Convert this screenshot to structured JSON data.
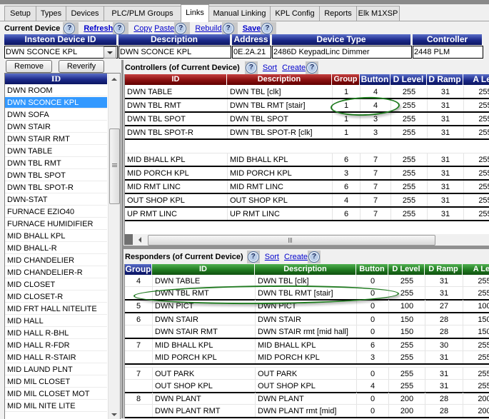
{
  "tabs": [
    "Setup",
    "Types",
    "Devices",
    "PLC/PLM Groups",
    "Links",
    "Manual Linking",
    "KPL Config",
    "Reports",
    "Elk M1XSP"
  ],
  "active_tab": "Links",
  "toolbar": {
    "current_device_label": "Current Device",
    "refresh": "Refresh",
    "copy": "Copy",
    "paste": "Paste",
    "rebuild": "Rebuild",
    "save": "Save",
    "help_glyph": "?"
  },
  "device": {
    "headers": [
      "Insteon Device ID",
      "Description",
      "Address",
      "Device Type",
      "Controller"
    ],
    "id": "DWN SCONCE KPL",
    "description": "DWN SCONCE KPL",
    "address": "0E.2A.21",
    "device_type": "2486D KeypadLinc Dimmer",
    "controller": "2448 PLM"
  },
  "buttons": {
    "remove": "Remove",
    "reverify": "Reverify"
  },
  "device_list": {
    "header": "ID",
    "selected": "DWN SCONCE KPL",
    "items": [
      "DWN ROOM",
      "DWN SCONCE KPL",
      "DWN SOFA",
      "DWN STAIR",
      "DWN STAIR RMT",
      "DWN TABLE",
      "DWN TBL RMT",
      "DWN TBL SPOT",
      "DWN TBL SPOT-R",
      "DWN-STAT",
      "FURNACE EZIO40",
      "FURNACE HUMIDIFIER",
      "MID BHALL KPL",
      "MID BHALL-R",
      "MID CHANDELIER",
      "MID CHANDELIER-R",
      "MID CLOSET",
      "MID CLOSET-R",
      "MID FRT HALL NITELITE",
      "MID HALL",
      "MID HALL R-BHL",
      "MID HALL R-FDR",
      "MID HALL R-STAIR",
      "MID LAUND PLNT",
      "MID MIL CLOSET",
      "MID MIL CLOSET MOT",
      "MID MIL NITE LITE"
    ]
  },
  "controllers": {
    "title": "Controllers (of Current Device)",
    "sort": "Sort",
    "create": "Create",
    "headers": [
      "ID",
      "Description",
      "Group",
      "Button",
      "D Level",
      "D Ramp",
      "A Lev"
    ],
    "rows": [
      {
        "id": "DWN TABLE",
        "desc": "DWN TBL [clk]",
        "group": "1",
        "button": "4",
        "dlevel": "255",
        "dramp": "31",
        "alevel": "255"
      },
      {
        "id": "DWN TBL RMT",
        "desc": "DWN TBL RMT [stair]",
        "group": "1",
        "button": "4",
        "dlevel": "255",
        "dramp": "31",
        "alevel": "255"
      },
      {
        "id": "DWN TBL SPOT",
        "desc": "DWN TBL SPOT",
        "group": "1",
        "button": "3",
        "dlevel": "255",
        "dramp": "31",
        "alevel": "255"
      },
      {
        "id": "DWN TBL SPOT-R",
        "desc": "DWN TBL SPOT-R [clk]",
        "group": "1",
        "button": "3",
        "dlevel": "255",
        "dramp": "31",
        "alevel": "255"
      },
      {
        "id": "MID BHALL KPL",
        "desc": "MID BHALL KPL",
        "group": "6",
        "button": "7",
        "dlevel": "255",
        "dramp": "31",
        "alevel": "255"
      },
      {
        "id": "MID PORCH KPL",
        "desc": "MID PORCH KPL",
        "group": "3",
        "button": "7",
        "dlevel": "255",
        "dramp": "31",
        "alevel": "255"
      },
      {
        "id": "MID RMT LINC",
        "desc": "MID RMT LINC",
        "group": "6",
        "button": "7",
        "dlevel": "255",
        "dramp": "31",
        "alevel": "255"
      },
      {
        "id": "OUT SHOP KPL",
        "desc": "OUT SHOP KPL",
        "group": "4",
        "button": "7",
        "dlevel": "255",
        "dramp": "31",
        "alevel": "255"
      },
      {
        "id": "UP RMT LINC",
        "desc": "UP RMT LINC",
        "group": "6",
        "button": "7",
        "dlevel": "255",
        "dramp": "31",
        "alevel": "255"
      }
    ]
  },
  "responders": {
    "title": "Responders (of Current Device)",
    "sort": "Sort",
    "create": "Create",
    "headers": [
      "Group",
      "ID",
      "Description",
      "Button",
      "D Level",
      "D Ramp",
      "A Lev"
    ],
    "rows": [
      {
        "group": "4",
        "id": "DWN TABLE",
        "desc": "DWN TBL [clk]",
        "button": "0",
        "dlevel": "255",
        "dramp": "31",
        "alevel": "255"
      },
      {
        "group": "",
        "id": "DWN TBL RMT",
        "desc": "DWN TBL RMT [stair]",
        "button": "0",
        "dlevel": "255",
        "dramp": "31",
        "alevel": "255"
      },
      {
        "group": "5",
        "id": "DWN PICT",
        "desc": "DWN PICT",
        "button": "0",
        "dlevel": "100",
        "dramp": "27",
        "alevel": "100"
      },
      {
        "group": "6",
        "id": "DWN STAIR",
        "desc": "DWN STAIR",
        "button": "0",
        "dlevel": "150",
        "dramp": "28",
        "alevel": "150"
      },
      {
        "group": "",
        "id": "DWN STAIR RMT",
        "desc": "DWN STAIR rmt [mid hall]",
        "button": "0",
        "dlevel": "150",
        "dramp": "28",
        "alevel": "150"
      },
      {
        "group": "7",
        "id": "MID BHALL KPL",
        "desc": "MID BHALL KPL",
        "button": "6",
        "dlevel": "255",
        "dramp": "30",
        "alevel": "255"
      },
      {
        "group": "",
        "id": "MID PORCH KPL",
        "desc": "MID PORCH KPL",
        "button": "3",
        "dlevel": "255",
        "dramp": "31",
        "alevel": "255"
      },
      {
        "group": "7",
        "id": "OUT PARK",
        "desc": "OUT PARK",
        "button": "0",
        "dlevel": "255",
        "dramp": "31",
        "alevel": "255"
      },
      {
        "group": "",
        "id": "OUT SHOP KPL",
        "desc": "OUT SHOP KPL",
        "button": "4",
        "dlevel": "255",
        "dramp": "31",
        "alevel": "255"
      },
      {
        "group": "8",
        "id": "DWN PLANT",
        "desc": "DWN PLANT",
        "button": "0",
        "dlevel": "200",
        "dramp": "28",
        "alevel": "200"
      },
      {
        "group": "",
        "id": "DWN PLANT RMT",
        "desc": "DWN PLANT rmt [mid]",
        "button": "0",
        "dlevel": "200",
        "dramp": "28",
        "alevel": "200"
      }
    ]
  },
  "colors": {
    "controllers_header": "#8a1010",
    "controllers_num_header": "#1c2a8a",
    "responders_header": "#207a20",
    "selection": "#3399ff",
    "highlight_ellipse": "#1f7a1f",
    "link": "#0000cc"
  }
}
